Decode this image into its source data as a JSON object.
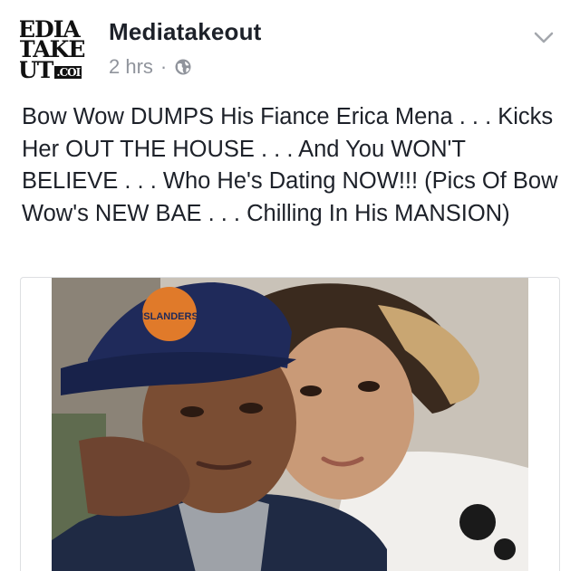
{
  "post": {
    "page_name": "Mediatakeout",
    "avatar_logo_lines": [
      "EDIA",
      "TAKE",
      "UT"
    ],
    "avatar_logo_suffix": ".COI",
    "time": "2 hrs",
    "separator": "·",
    "privacy_icon": "globe-icon",
    "menu_icon": "chevron-down-icon",
    "text": "Bow Wow DUMPS His Fiance Erica Mena . . . Kicks Her OUT THE HOUSE . . . And You WON'T BELIEVE . . . Who He's Dating NOW!!! (Pics Of Bow Wow's NEW BAE . . . Chilling In His MANSION)",
    "cap_logo_text": "ISLANDERS"
  },
  "colors": {
    "text": "#1d2129",
    "secondary": "#90949c",
    "border": "#dddfe2"
  }
}
